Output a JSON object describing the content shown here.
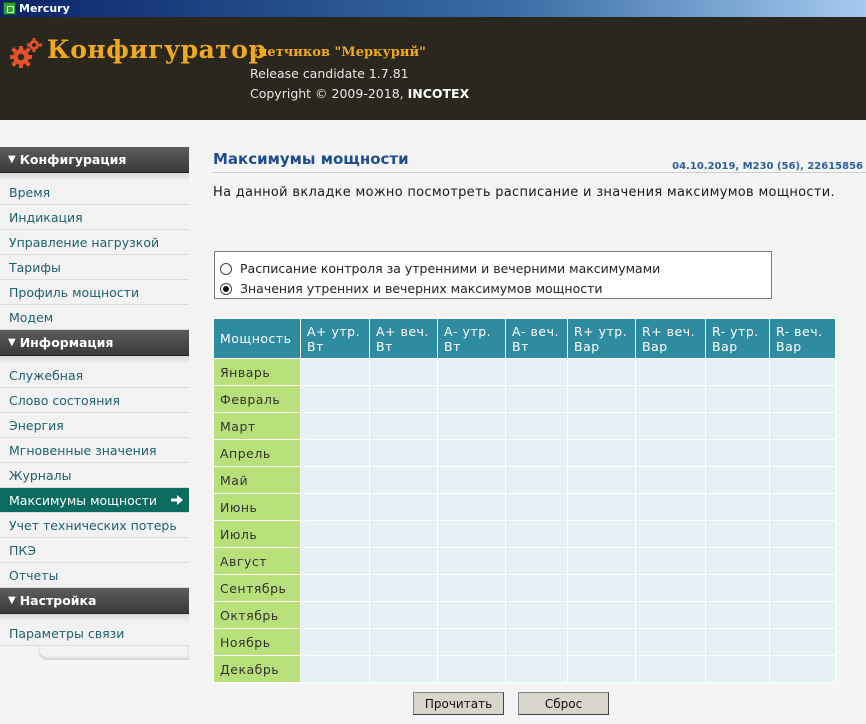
{
  "window": {
    "title": "Mercury"
  },
  "header": {
    "brand": "Конфигуратор",
    "subtitle": "счетчиков \"Меркурий\"",
    "release": "Release candidate 1.7.81",
    "copyright_prefix": "Copyright © 2009-2018, ",
    "copyright_company": "INCOTEX",
    "brand_color": "#f0a820"
  },
  "sidebar": {
    "sections": [
      {
        "title": "Конфигурация",
        "items": [
          "Время",
          "Индикация",
          "Управление нагрузкой",
          "Тарифы",
          "Профиль мощности",
          "Модем"
        ]
      },
      {
        "title": "Информация",
        "items": [
          "Служебная",
          "Слово состояния",
          "Энергия",
          "Мгновенные значения",
          "Журналы",
          "Максимумы мощности",
          "Учет технических потерь",
          "ПКЭ",
          "Отчеты"
        ]
      },
      {
        "title": "Настройка",
        "items": [
          "Параметры связи"
        ]
      }
    ],
    "active_item": "Максимумы мощности",
    "active_color": "#0a6b5e"
  },
  "main": {
    "title": "Максимумы мощности",
    "info": "04.10.2019, M230 (56), 22615856",
    "description": "На данной вкладке можно посмотреть расписание и значения максимумов мощности.",
    "radio_options": [
      {
        "label": "Расписание контроля за утренними и вечерними максимумами",
        "checked": false
      },
      {
        "label": "Значения утренних и вечерних максимумов мощности",
        "checked": true
      }
    ],
    "table": {
      "corner": "Мощность",
      "columns": [
        "А+ утр. Вт",
        "А+ веч. Вт",
        "А- утр. Вт",
        "А- веч. Вт",
        "R+ утр. Вар",
        "R+ веч. Вар",
        "R- утр. Вар",
        "R- веч. Вар"
      ],
      "rows": [
        "Январь",
        "Февраль",
        "Март",
        "Апрель",
        "Май",
        "Июнь",
        "Июль",
        "Август",
        "Сентябрь",
        "Октябрь",
        "Ноябрь",
        "Декабрь"
      ],
      "header_color": "#2f8b9f",
      "month_color": "#b8e07a"
    },
    "buttons": {
      "read": "Прочитать",
      "reset": "Сброс"
    }
  }
}
